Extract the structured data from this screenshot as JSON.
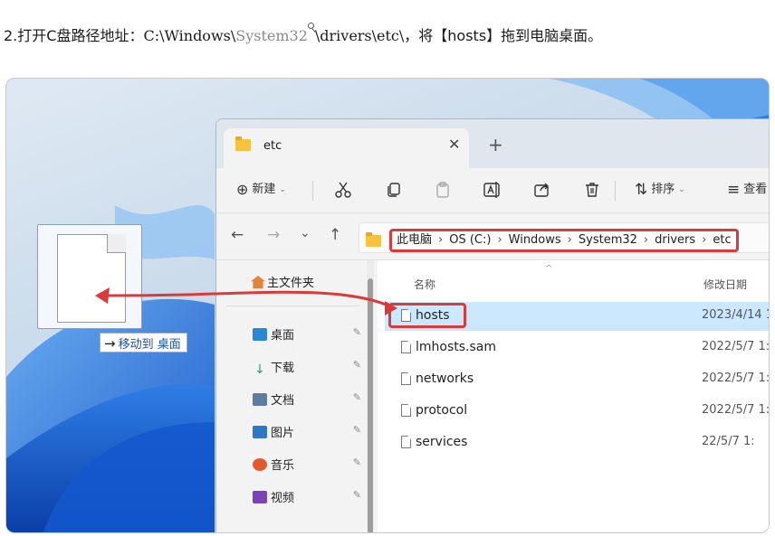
{
  "instruction": {
    "prefix": "2.打开C盘路径地址：",
    "path_a": "C:\\Windows\\",
    "path_s32": "System32",
    "path_b": "\\drivers\\etc\\",
    "suffix": "，将【hosts】拖到电脑桌面。"
  },
  "desktop": {
    "move_tip_arrow": "→",
    "move_tip_label": "移动到 桌面"
  },
  "window": {
    "tab_title": "etc",
    "tab_close": "✕",
    "new_tab": "+",
    "command_bar": {
      "new_icon": "⊕",
      "new_label": "新建",
      "new_caret": "⌄",
      "sort_icon": "⇅",
      "sort_label": "排序",
      "sort_caret": "⌄",
      "view_icon": "≡",
      "view_label": "查看"
    },
    "nav": {
      "back": "←",
      "forward": "→",
      "recent": "⌄",
      "up": "↑"
    },
    "breadcrumbs": [
      "此电脑",
      "OS (C:)",
      "Windows",
      "System32",
      "drivers",
      "etc"
    ],
    "breadcrumb_sep": "›",
    "sidebar": {
      "home": "主文件夹",
      "pin_icon": "✎",
      "quick_access": [
        {
          "label": "桌面",
          "icon": "desktop-icon",
          "color": "#2b86d4"
        },
        {
          "label": "下载",
          "icon": "download-icon",
          "color": "#2aa15a"
        },
        {
          "label": "文档",
          "icon": "document-icon",
          "color": "#5d7da0"
        },
        {
          "label": "图片",
          "icon": "pictures-icon",
          "color": "#2f78c5"
        },
        {
          "label": "音乐",
          "icon": "music-icon",
          "color": "#e15a2f"
        },
        {
          "label": "视频",
          "icon": "video-icon",
          "color": "#7a43b6"
        }
      ]
    },
    "columns": {
      "name": "名称",
      "modified": "修改日期",
      "sort_caret": "^"
    },
    "files": [
      {
        "name": "hosts",
        "modified": "2023/4/14 1",
        "selected": true
      },
      {
        "name": "lmhosts.sam",
        "modified": "2022/5/7 1:",
        "selected": false
      },
      {
        "name": "networks",
        "modified": "2022/5/7 1:",
        "selected": false
      },
      {
        "name": "protocol",
        "modified": "2022/5/7 1:",
        "selected": false
      },
      {
        "name": "services",
        "modified": "22/5/7 1:",
        "selected": false
      }
    ]
  },
  "colors": {
    "highlight_red": "#d73b3b",
    "selection_blue": "#cce8ff",
    "accent": "#1a4fb0"
  }
}
